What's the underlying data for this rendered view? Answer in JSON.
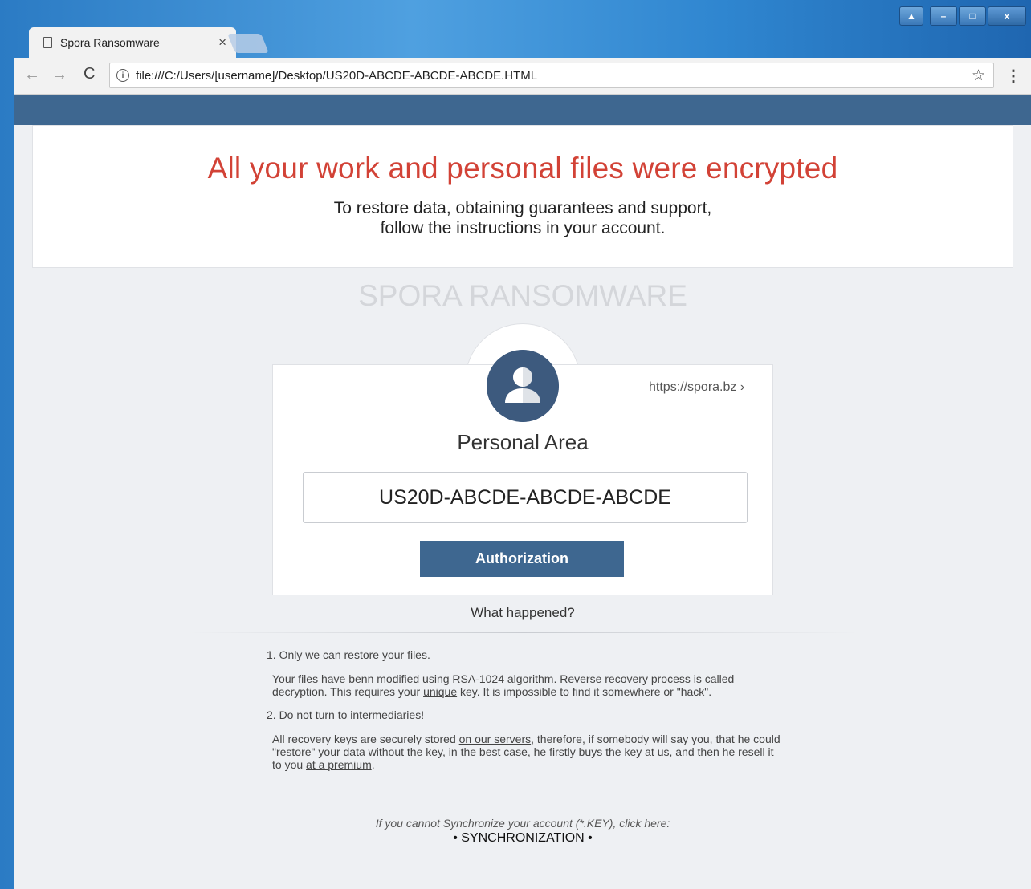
{
  "browser": {
    "tab_title": "Spora Ransomware",
    "tab_close": "×",
    "url": "file:///C:/Users/[username]/Desktop/US20D-ABCDE-ABCDE-ABCDE.HTML",
    "info_glyph": "i",
    "back_glyph": "←",
    "forward_glyph": "→",
    "reload_glyph": "C",
    "star_glyph": "☆",
    "menu_glyph": "⋮",
    "window_controls": {
      "minimize": "–",
      "maximize": "□",
      "close": "x",
      "user": "▲"
    }
  },
  "page": {
    "headline": "All your work and personal files were encrypted",
    "subline_1": "To restore data, obtaining guarantees and support,",
    "subline_2": "follow the instructions in your account.",
    "brand": "SPORA RANSOMWARE",
    "spora_link": "https://spora.bz ›",
    "area_title": "Personal Area",
    "id_value": "US20D-ABCDE-ABCDE-ABCDE",
    "auth_button": "Authorization",
    "what_happened": "What happened?",
    "sync_note": "If you cannot Synchronize your account (*.KEY), click here:",
    "sync_link": "• SYNCHRONIZATION •"
  },
  "info": {
    "h1": "1. Only we can restore your files.",
    "p1_a": "Your files have benn modified using RSA-1024 algorithm. Reverse recovery process is called decryption. This requires your ",
    "p1_u": "unique",
    "p1_b": " key. It is impossible to find it somewhere or \"hack\".",
    "h2": "2. Do not turn to intermediaries!",
    "p2_a": "All recovery keys are securely stored ",
    "p2_u1": "on our servers",
    "p2_b": ", therefore, if somebody will say you, that he could \"restore\" your data without the key, in the best case, he firstly buys the key ",
    "p2_u2": "at us",
    "p2_c": ", and then he resell it to you ",
    "p2_u3": "at a premium",
    "p2_d": "."
  },
  "colors": {
    "headline": "#d24236",
    "brand_band": "#3e6790",
    "avatar": "#3d5a7e"
  }
}
